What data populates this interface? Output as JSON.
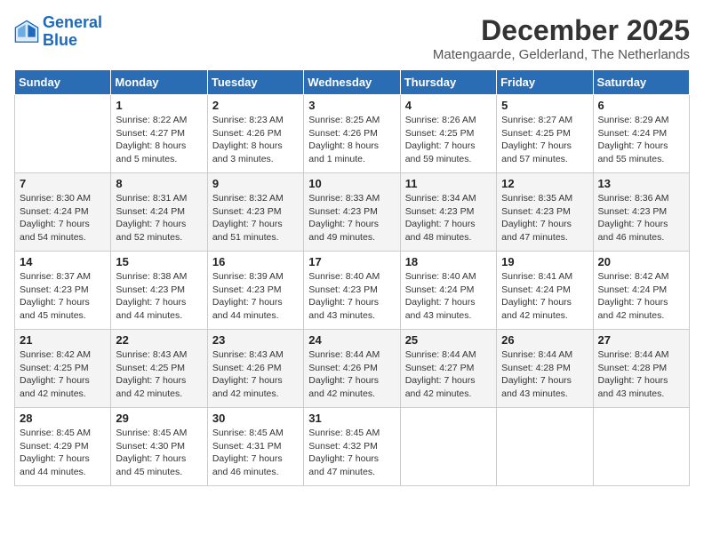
{
  "logo": {
    "line1": "General",
    "line2": "Blue"
  },
  "title": "December 2025",
  "location": "Matengaarde, Gelderland, The Netherlands",
  "weekdays": [
    "Sunday",
    "Monday",
    "Tuesday",
    "Wednesday",
    "Thursday",
    "Friday",
    "Saturday"
  ],
  "weeks": [
    [
      {
        "day": "",
        "info": ""
      },
      {
        "day": "1",
        "info": "Sunrise: 8:22 AM\nSunset: 4:27 PM\nDaylight: 8 hours\nand 5 minutes."
      },
      {
        "day": "2",
        "info": "Sunrise: 8:23 AM\nSunset: 4:26 PM\nDaylight: 8 hours\nand 3 minutes."
      },
      {
        "day": "3",
        "info": "Sunrise: 8:25 AM\nSunset: 4:26 PM\nDaylight: 8 hours\nand 1 minute."
      },
      {
        "day": "4",
        "info": "Sunrise: 8:26 AM\nSunset: 4:25 PM\nDaylight: 7 hours\nand 59 minutes."
      },
      {
        "day": "5",
        "info": "Sunrise: 8:27 AM\nSunset: 4:25 PM\nDaylight: 7 hours\nand 57 minutes."
      },
      {
        "day": "6",
        "info": "Sunrise: 8:29 AM\nSunset: 4:24 PM\nDaylight: 7 hours\nand 55 minutes."
      }
    ],
    [
      {
        "day": "7",
        "info": "Sunrise: 8:30 AM\nSunset: 4:24 PM\nDaylight: 7 hours\nand 54 minutes."
      },
      {
        "day": "8",
        "info": "Sunrise: 8:31 AM\nSunset: 4:24 PM\nDaylight: 7 hours\nand 52 minutes."
      },
      {
        "day": "9",
        "info": "Sunrise: 8:32 AM\nSunset: 4:23 PM\nDaylight: 7 hours\nand 51 minutes."
      },
      {
        "day": "10",
        "info": "Sunrise: 8:33 AM\nSunset: 4:23 PM\nDaylight: 7 hours\nand 49 minutes."
      },
      {
        "day": "11",
        "info": "Sunrise: 8:34 AM\nSunset: 4:23 PM\nDaylight: 7 hours\nand 48 minutes."
      },
      {
        "day": "12",
        "info": "Sunrise: 8:35 AM\nSunset: 4:23 PM\nDaylight: 7 hours\nand 47 minutes."
      },
      {
        "day": "13",
        "info": "Sunrise: 8:36 AM\nSunset: 4:23 PM\nDaylight: 7 hours\nand 46 minutes."
      }
    ],
    [
      {
        "day": "14",
        "info": "Sunrise: 8:37 AM\nSunset: 4:23 PM\nDaylight: 7 hours\nand 45 minutes."
      },
      {
        "day": "15",
        "info": "Sunrise: 8:38 AM\nSunset: 4:23 PM\nDaylight: 7 hours\nand 44 minutes."
      },
      {
        "day": "16",
        "info": "Sunrise: 8:39 AM\nSunset: 4:23 PM\nDaylight: 7 hours\nand 44 minutes."
      },
      {
        "day": "17",
        "info": "Sunrise: 8:40 AM\nSunset: 4:23 PM\nDaylight: 7 hours\nand 43 minutes."
      },
      {
        "day": "18",
        "info": "Sunrise: 8:40 AM\nSunset: 4:24 PM\nDaylight: 7 hours\nand 43 minutes."
      },
      {
        "day": "19",
        "info": "Sunrise: 8:41 AM\nSunset: 4:24 PM\nDaylight: 7 hours\nand 42 minutes."
      },
      {
        "day": "20",
        "info": "Sunrise: 8:42 AM\nSunset: 4:24 PM\nDaylight: 7 hours\nand 42 minutes."
      }
    ],
    [
      {
        "day": "21",
        "info": "Sunrise: 8:42 AM\nSunset: 4:25 PM\nDaylight: 7 hours\nand 42 minutes."
      },
      {
        "day": "22",
        "info": "Sunrise: 8:43 AM\nSunset: 4:25 PM\nDaylight: 7 hours\nand 42 minutes."
      },
      {
        "day": "23",
        "info": "Sunrise: 8:43 AM\nSunset: 4:26 PM\nDaylight: 7 hours\nand 42 minutes."
      },
      {
        "day": "24",
        "info": "Sunrise: 8:44 AM\nSunset: 4:26 PM\nDaylight: 7 hours\nand 42 minutes."
      },
      {
        "day": "25",
        "info": "Sunrise: 8:44 AM\nSunset: 4:27 PM\nDaylight: 7 hours\nand 42 minutes."
      },
      {
        "day": "26",
        "info": "Sunrise: 8:44 AM\nSunset: 4:28 PM\nDaylight: 7 hours\nand 43 minutes."
      },
      {
        "day": "27",
        "info": "Sunrise: 8:44 AM\nSunset: 4:28 PM\nDaylight: 7 hours\nand 43 minutes."
      }
    ],
    [
      {
        "day": "28",
        "info": "Sunrise: 8:45 AM\nSunset: 4:29 PM\nDaylight: 7 hours\nand 44 minutes."
      },
      {
        "day": "29",
        "info": "Sunrise: 8:45 AM\nSunset: 4:30 PM\nDaylight: 7 hours\nand 45 minutes."
      },
      {
        "day": "30",
        "info": "Sunrise: 8:45 AM\nSunset: 4:31 PM\nDaylight: 7 hours\nand 46 minutes."
      },
      {
        "day": "31",
        "info": "Sunrise: 8:45 AM\nSunset: 4:32 PM\nDaylight: 7 hours\nand 47 minutes."
      },
      {
        "day": "",
        "info": ""
      },
      {
        "day": "",
        "info": ""
      },
      {
        "day": "",
        "info": ""
      }
    ]
  ]
}
